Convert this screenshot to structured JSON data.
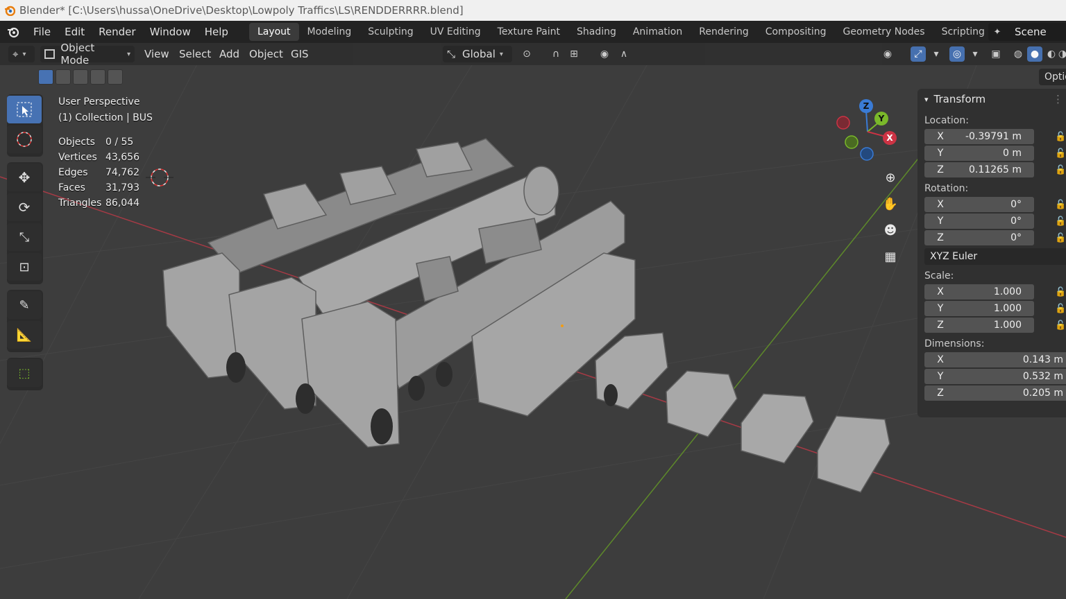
{
  "window": {
    "title": "Blender* [C:\\Users\\hussa\\OneDrive\\Desktop\\Lowpoly Traffics\\LS\\RENDDERRRR.blend]"
  },
  "menu": {
    "items": [
      "File",
      "Edit",
      "Render",
      "Window",
      "Help"
    ]
  },
  "workspaces": {
    "tabs": [
      "Layout",
      "Modeling",
      "Sculpting",
      "UV Editing",
      "Texture Paint",
      "Shading",
      "Animation",
      "Rendering",
      "Compositing",
      "Geometry Nodes",
      "Scripting"
    ],
    "active": "Layout",
    "add_symbol": "+"
  },
  "scene": {
    "label": "Scene"
  },
  "viewport_header": {
    "mode": "Object Mode",
    "menus": [
      "View",
      "Select",
      "Add",
      "Object",
      "GIS"
    ],
    "orientation": "Global",
    "options_tab": "Options"
  },
  "overlay": {
    "perspective": "User Perspective",
    "collection": "(1) Collection | BUS",
    "stats": [
      {
        "label": "Objects",
        "value": "0 / 55"
      },
      {
        "label": "Vertices",
        "value": "43,656"
      },
      {
        "label": "Edges",
        "value": "74,762"
      },
      {
        "label": "Faces",
        "value": "31,793"
      },
      {
        "label": "Triangles",
        "value": "86,044"
      }
    ]
  },
  "gizmo": {
    "x": "X",
    "y": "Y",
    "z": "Z"
  },
  "transform": {
    "title": "Transform",
    "location_label": "Location:",
    "location": {
      "x": "-0.39791 m",
      "y": "0 m",
      "z": "0.11265 m"
    },
    "rotation_label": "Rotation:",
    "rotation": {
      "x": "0°",
      "y": "0°",
      "z": "0°"
    },
    "rotation_mode": "XYZ Euler",
    "scale_label": "Scale:",
    "scale": {
      "x": "1.000",
      "y": "1.000",
      "z": "1.000"
    },
    "dimensions_label": "Dimensions:",
    "dimensions": {
      "x": "0.143 m",
      "y": "0.532 m",
      "z": "0.205 m"
    },
    "axis_labels": {
      "x": "X",
      "y": "Y",
      "z": "Z"
    }
  },
  "colors": {
    "accent": "#4772b3",
    "axis_x": "#cc3344",
    "axis_y": "#7ab82a",
    "axis_z": "#3a7bd5",
    "viewport_bg": "#3d3d3d"
  }
}
